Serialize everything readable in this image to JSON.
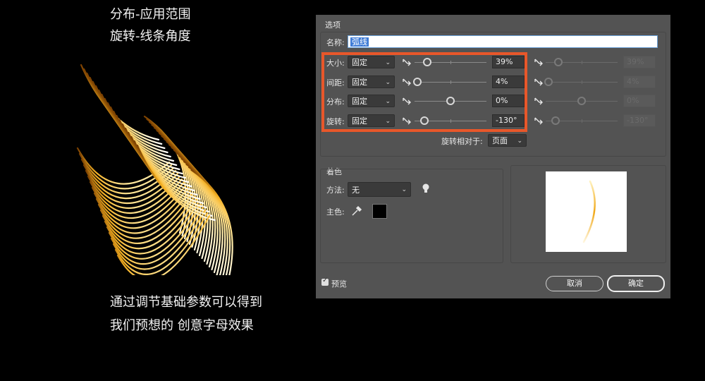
{
  "captions": {
    "top1": "分布-应用范围",
    "top2": "旋转-线条角度",
    "bottom1": "通过调节基础参数可以得到",
    "bottom2": "我们预想的 创意字母效果"
  },
  "dialog": {
    "section_title": "选项",
    "name_label": "名称:",
    "name_value": "弧线",
    "params": [
      {
        "label": "大小:",
        "mode": "固定",
        "value": "39%",
        "right_value": "39%",
        "level": 0.18,
        "right_level": 0.18
      },
      {
        "label": "间距:",
        "mode": "固定",
        "value": "4%",
        "right_value": "4%",
        "level": 0.04,
        "right_level": 0.04
      },
      {
        "label": "分布:",
        "mode": "固定",
        "value": "0%",
        "right_value": "0%",
        "level": 0.5,
        "right_level": 0.5
      },
      {
        "label": "旋转:",
        "mode": "固定",
        "value": "-130°",
        "right_value": "-130°",
        "level": 0.14,
        "right_level": 0.14
      }
    ],
    "rotate_relative_label": "旋转相对于:",
    "rotate_relative_value": "页面",
    "coloring": {
      "title": "着色",
      "method_label": "方法:",
      "method_value": "无",
      "key_color_label": "主色:",
      "key_color": "#000000"
    },
    "preview_label": "预览",
    "preview_checked": true,
    "cancel_label": "取消",
    "ok_label": "确定"
  },
  "colors": {
    "highlight_border": "#e8572a",
    "dialog_bg": "#535353",
    "stroke_gold": "#f5b022"
  }
}
